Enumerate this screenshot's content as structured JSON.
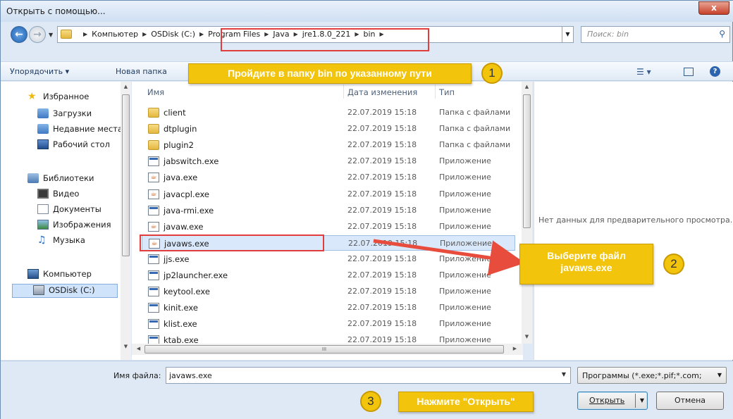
{
  "window": {
    "title": "Открыть с помощью...",
    "close_label": "x"
  },
  "address": {
    "crumbs": [
      "Компьютер",
      "OSDisk (C:)",
      "Program Files",
      "Java",
      "jre1.8.0_221",
      "bin"
    ],
    "search_placeholder": "Поиск: bin"
  },
  "toolbar": {
    "organize_label": "Упорядочить ▾",
    "new_folder_label": "Новая папка"
  },
  "nav": {
    "favorites": "Избранное",
    "downloads": "Загрузки",
    "recent": "Недавние места",
    "desktop": "Рабочий стол",
    "libraries": "Библиотеки",
    "video": "Видео",
    "documents": "Документы",
    "images": "Изображения",
    "music": "Музыка",
    "computer": "Компьютер",
    "drive": "OSDisk (C:)"
  },
  "columns": {
    "name": "Имя",
    "date": "Дата изменения",
    "type": "Тип"
  },
  "files": [
    {
      "name": "client",
      "date": "22.07.2019 15:18",
      "type": "Папка с файлами",
      "icon": "folder"
    },
    {
      "name": "dtplugin",
      "date": "22.07.2019 15:18",
      "type": "Папка с файлами",
      "icon": "folder"
    },
    {
      "name": "plugin2",
      "date": "22.07.2019 15:18",
      "type": "Папка с файлами",
      "icon": "folder"
    },
    {
      "name": "jabswitch.exe",
      "date": "22.07.2019 15:18",
      "type": "Приложение",
      "icon": "exe"
    },
    {
      "name": "java.exe",
      "date": "22.07.2019 15:18",
      "type": "Приложение",
      "icon": "java"
    },
    {
      "name": "javacpl.exe",
      "date": "22.07.2019 15:18",
      "type": "Приложение",
      "icon": "java"
    },
    {
      "name": "java-rmi.exe",
      "date": "22.07.2019 15:18",
      "type": "Приложение",
      "icon": "exe"
    },
    {
      "name": "javaw.exe",
      "date": "22.07.2019 15:18",
      "type": "Приложение",
      "icon": "java"
    },
    {
      "name": "javaws.exe",
      "date": "22.07.2019 15:18",
      "type": "Приложение",
      "icon": "java"
    },
    {
      "name": "jjs.exe",
      "date": "22.07.2019 15:18",
      "type": "Приложение",
      "icon": "exe"
    },
    {
      "name": "jp2launcher.exe",
      "date": "22.07.2019 15:18",
      "type": "Приложение",
      "icon": "exe"
    },
    {
      "name": "keytool.exe",
      "date": "22.07.2019 15:18",
      "type": "Приложение",
      "icon": "exe"
    },
    {
      "name": "kinit.exe",
      "date": "22.07.2019 15:18",
      "type": "Приложение",
      "icon": "exe"
    },
    {
      "name": "klist.exe",
      "date": "22.07.2019 15:18",
      "type": "Приложение",
      "icon": "exe"
    },
    {
      "name": "ktab.exe",
      "date": "22.07.2019 15:18",
      "type": "Приложение",
      "icon": "exe"
    }
  ],
  "selected_file_index": 8,
  "preview": {
    "empty_text": "Нет данных для предварительного просмотра."
  },
  "bottom": {
    "filename_label": "Имя файла:",
    "filename_value": "javaws.exe",
    "filter_value": "Программы (*.exe;*.pif;*.com;",
    "open_label": "Открыть",
    "cancel_label": "Отмена"
  },
  "annotations": {
    "step1_text": "Пройдите в папку bin по указанному пути",
    "step1_num": "1",
    "step2_text_line1": "Выберите файл",
    "step2_text_line2": "javaws.exe",
    "step2_num": "2",
    "step3_text": "Нажмите \"Открыть\"",
    "step3_num": "3",
    "accent": "#f2c40c",
    "highlight": "#e23d3d"
  }
}
